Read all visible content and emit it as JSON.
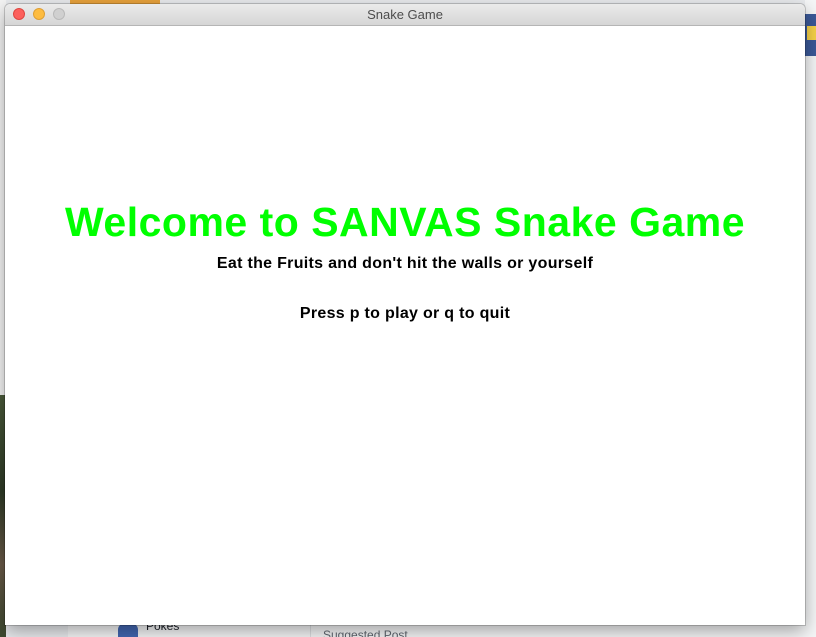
{
  "window": {
    "title": "Snake Game"
  },
  "game": {
    "welcome_text": "Welcome to SANVAS Snake Game",
    "instructions": "Eat the Fruits and don't hit the walls or yourself",
    "prompt": "Press p to play or q to quit",
    "accent_color": "#00ff00",
    "background_color": "#ffffff"
  },
  "background": {
    "pokes_label": "Pokes",
    "suggested_label": "Suggested Post"
  }
}
